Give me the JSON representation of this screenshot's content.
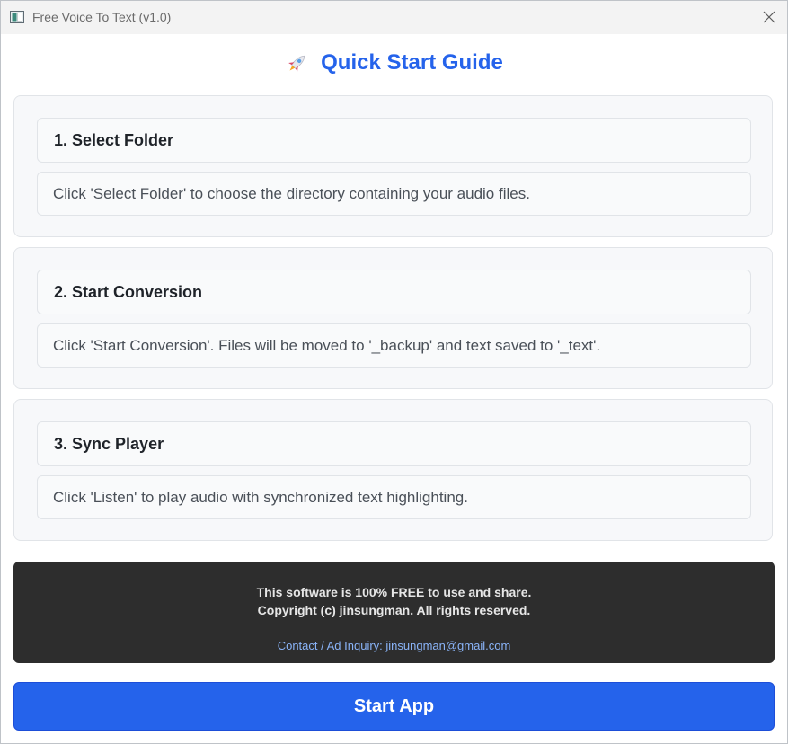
{
  "window": {
    "title": "Free Voice To Text (v1.0)"
  },
  "guide": {
    "heading": "Quick Start Guide",
    "heading_icon": "rocket-icon",
    "steps": [
      {
        "title": "1. Select Folder",
        "description": "Click 'Select Folder' to choose the directory containing your audio files."
      },
      {
        "title": "2. Start Conversion",
        "description": "Click 'Start Conversion'. Files will be moved to '_backup' and text saved to '_text'."
      },
      {
        "title": "3. Sync Player",
        "description": "Click 'Listen' to play audio with synchronized text highlighting."
      }
    ]
  },
  "footer": {
    "line1": "This software is 100% FREE to use and share.",
    "line2": "Copyright (c) jinsungman. All rights reserved.",
    "contact": "Contact / Ad Inquiry: jinsungman@gmail.com"
  },
  "actions": {
    "start_label": "Start App"
  },
  "colors": {
    "accent": "#2563eb",
    "footer_bg": "#2d2d2d",
    "link": "#8ab4f8"
  }
}
